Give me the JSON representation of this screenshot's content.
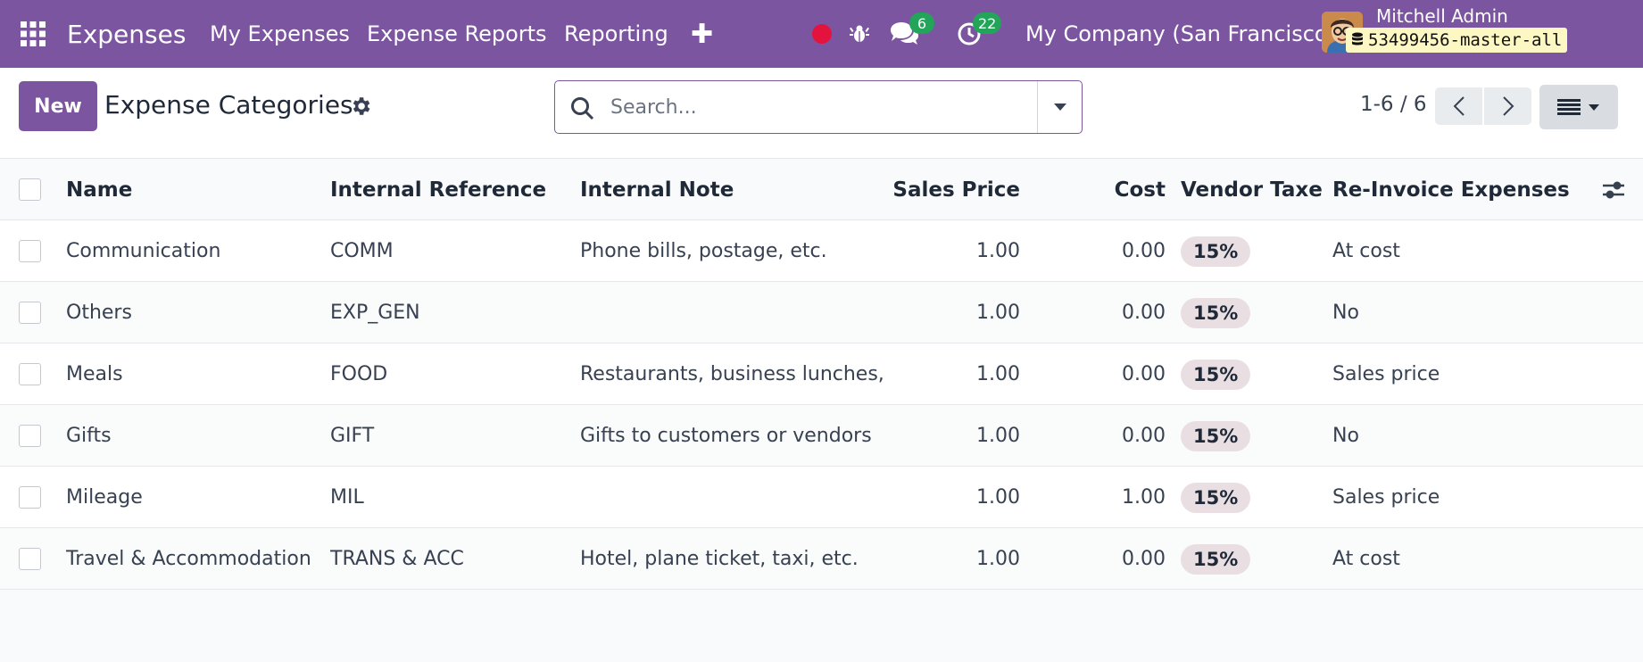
{
  "navbar": {
    "app_name": "Expenses",
    "menu": [
      "My Expenses",
      "Expense Reports",
      "Reporting"
    ],
    "chat_count": "6",
    "activity_count": "22",
    "company": "My Company (San Francisco)",
    "user_name": "Mitchell Admin",
    "database": "53499456-master-all",
    "brand_color": "#7c55a0"
  },
  "control": {
    "new_label": "New",
    "title": "Expense Categories",
    "search_placeholder": "Search...",
    "pager": "1-6 / 6"
  },
  "table": {
    "headers": {
      "name": "Name",
      "ref": "Internal Reference",
      "note": "Internal Note",
      "sales": "Sales Price",
      "cost": "Cost",
      "taxes": "Vendor Taxes",
      "reinvoice": "Re-Invoice Expenses"
    },
    "rows": [
      {
        "name": "Communication",
        "ref": "COMM",
        "note": "Phone bills, postage, etc.",
        "sales": "1.00",
        "cost": "0.00",
        "tax": "15%",
        "reinvoice": "At cost"
      },
      {
        "name": "Others",
        "ref": "EXP_GEN",
        "note": "",
        "sales": "1.00",
        "cost": "0.00",
        "tax": "15%",
        "reinvoice": "No"
      },
      {
        "name": "Meals",
        "ref": "FOOD",
        "note": "Restaurants, business lunches,",
        "sales": "1.00",
        "cost": "0.00",
        "tax": "15%",
        "reinvoice": "Sales price"
      },
      {
        "name": "Gifts",
        "ref": "GIFT",
        "note": "Gifts to customers or vendors",
        "sales": "1.00",
        "cost": "0.00",
        "tax": "15%",
        "reinvoice": "No"
      },
      {
        "name": "Mileage",
        "ref": "MIL",
        "note": "",
        "sales": "1.00",
        "cost": "1.00",
        "tax": "15%",
        "reinvoice": "Sales price"
      },
      {
        "name": "Travel & Accommodation",
        "ref": "TRANS & ACC",
        "note": "Hotel, plane ticket, taxi, etc.",
        "sales": "1.00",
        "cost": "0.00",
        "tax": "15%",
        "reinvoice": "At cost"
      }
    ]
  }
}
